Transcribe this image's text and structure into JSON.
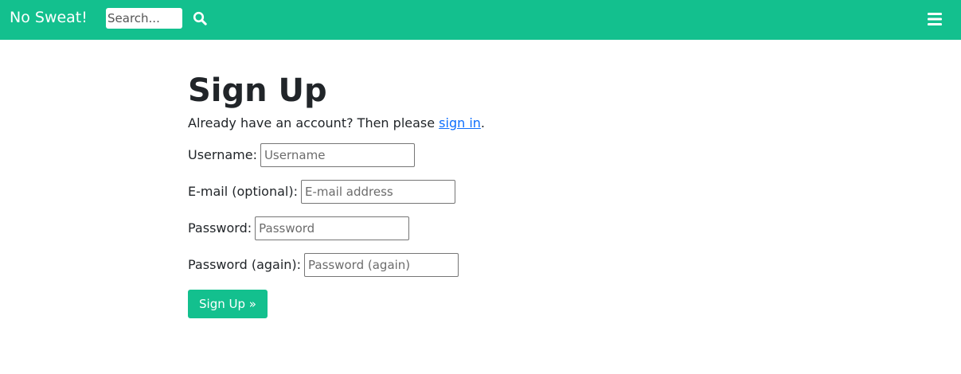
{
  "navbar": {
    "brand": "No Sweat!",
    "search_placeholder": "Search...",
    "search_icon": "magnifying-glass-icon",
    "menu_icon": "hamburger-menu-icon",
    "background_color": "#13c08e"
  },
  "main": {
    "title": "Sign Up",
    "intro_prefix": "Already have an account? Then please ",
    "intro_link": "sign in",
    "intro_suffix": ".",
    "fields": [
      {
        "label": "Username:",
        "placeholder": "Username",
        "value": ""
      },
      {
        "label": "E-mail (optional):",
        "placeholder": "E-mail address",
        "value": ""
      },
      {
        "label": "Password:",
        "placeholder": "Password",
        "value": ""
      },
      {
        "label": "Password (again):",
        "placeholder": "Password (again)",
        "value": ""
      }
    ],
    "submit_label": "Sign Up »",
    "link_color": "#0d6efd",
    "button_color": "#13c08e"
  }
}
